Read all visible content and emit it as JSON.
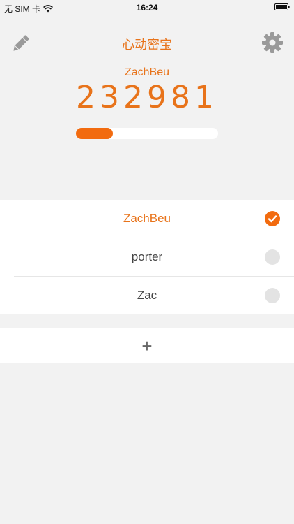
{
  "status_bar": {
    "carrier": "无 SIM 卡",
    "time": "16:24",
    "wifi_icon": "wifi-icon",
    "battery_icon": "battery-icon"
  },
  "nav": {
    "title": "心动密宝",
    "edit_icon": "pencil-icon",
    "settings_icon": "gear-icon"
  },
  "token": {
    "account": "ZachBeu",
    "code": "232981",
    "time_remaining_fraction": 0.26
  },
  "accounts": [
    {
      "name": "ZachBeu",
      "selected": true
    },
    {
      "name": "porter",
      "selected": false
    },
    {
      "name": "Zac",
      "selected": false
    }
  ],
  "add": {
    "label": "+"
  },
  "colors": {
    "accent": "#f26b0f",
    "background": "#f2f2f2"
  }
}
